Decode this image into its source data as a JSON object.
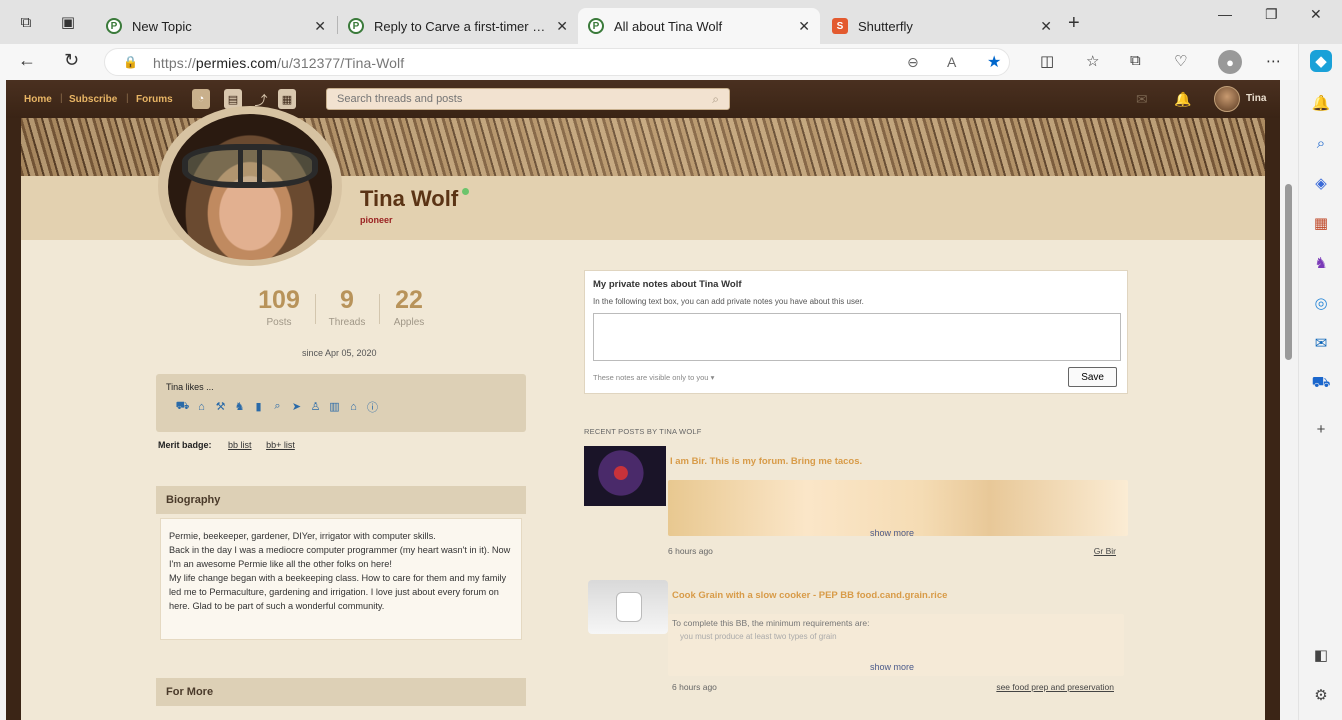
{
  "browser": {
    "tabs": [
      {
        "title": "New Topic",
        "favicon": "P"
      },
      {
        "title": "Reply to Carve a first-timer spoo",
        "favicon": "P"
      },
      {
        "title": "All about Tina Wolf",
        "favicon": "P",
        "active": true
      },
      {
        "title": "Shutterfly",
        "favicon": "S"
      }
    ],
    "url_prefix": "https://",
    "url_domain": "permies.com",
    "url_path": "/u/312377/Tina-Wolf",
    "accent": "#0066cc"
  },
  "site": {
    "nav": {
      "home": "Home",
      "subscribe": "Subscribe",
      "forums": "Forums"
    },
    "search_placeholder": "Search threads and posts",
    "user": "Tina"
  },
  "profile": {
    "name": "Tina Wolf",
    "role": "pioneer",
    "stats": [
      {
        "value": "109",
        "label": "Posts"
      },
      {
        "value": "9",
        "label": "Threads"
      },
      {
        "value": "22",
        "label": "Apples"
      }
    ],
    "since": "since Apr 05, 2020",
    "likes_title": "Tina likes ...",
    "merit_label": "Merit badge:",
    "merit_links": [
      "bb list",
      "bb+ list"
    ],
    "biography_title": "Biography",
    "biography": [
      "Permie, beekeeper, gardener, DIYer, irrigator with computer skills.",
      "Back in the day I was a mediocre computer programmer (my heart wasn't in it). Now I'm an awesome Permie like all the other folks on here!",
      "My life change began with a beekeeping class. How to care for them and my family led me to Permaculture, gardening and irrigation. I love just about every forum on here. Glad to be part of such a wonderful community."
    ],
    "for_more_title": "For More"
  },
  "notes": {
    "title": "My private notes about Tina Wolf",
    "description": "In the following text box, you can add private notes you have about this user.",
    "visibility": "These notes are visible only to you",
    "save_label": "Save"
  },
  "recent": {
    "title": "RECENT POSTS BY TINA WOLF",
    "posts": [
      {
        "title": "I am Bir. This is my forum. Bring me tacos.",
        "more": "show more",
        "ago": "6 hours ago",
        "forum": "Gr Bir"
      },
      {
        "title": "Cook Grain with a slow cooker - PEP BB food.cand.grain.rice",
        "excerpt_1": "To complete this BB, the minimum requirements are:",
        "excerpt_2": "you must produce at least two types of grain",
        "more": "show more",
        "ago": "6 hours ago",
        "forum": "see food prep and preservation"
      }
    ]
  }
}
